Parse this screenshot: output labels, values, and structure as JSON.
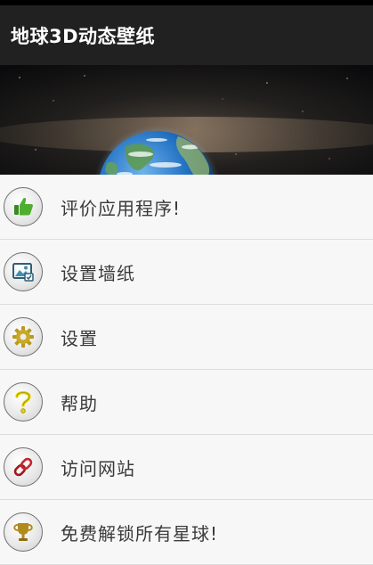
{
  "app": {
    "title": "地球3D动态壁纸"
  },
  "colors": {
    "appbar": "#212121",
    "background": "#f7f7f7",
    "label": "#3a3a3a",
    "divider": "#dcdcdc"
  },
  "hero": {
    "image": "earth-in-space"
  },
  "menu": {
    "items": [
      {
        "label": "评价应用程序!",
        "icon": "thumbs-up-icon"
      },
      {
        "label": "设置墙纸",
        "icon": "wallpaper-image-icon"
      },
      {
        "label": "设置",
        "icon": "gear-icon"
      },
      {
        "label": "帮助",
        "icon": "question-mark-icon"
      },
      {
        "label": "访问网站",
        "icon": "link-icon"
      },
      {
        "label": "免费解锁所有星球!",
        "icon": "trophy-icon"
      }
    ]
  }
}
